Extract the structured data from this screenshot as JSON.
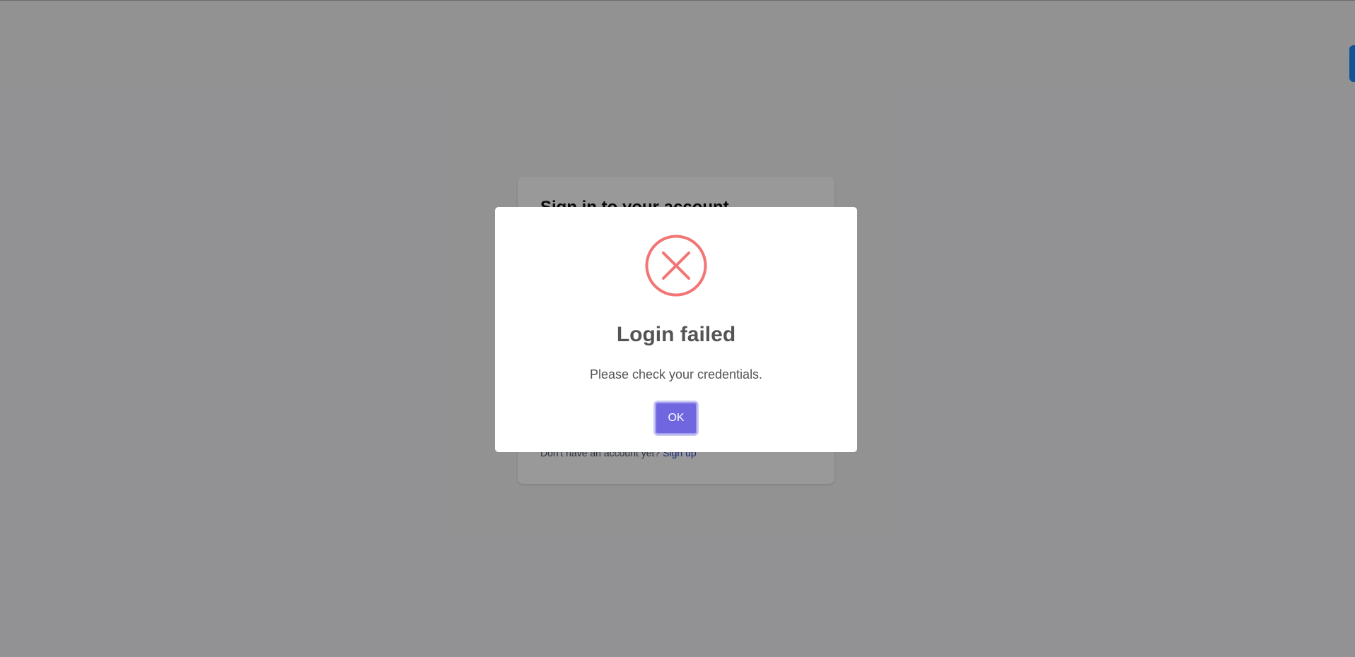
{
  "background": {
    "login_card": {
      "title": "Sign in to your account",
      "signup_prompt": "Don't have an account yet?",
      "signup_link": "Sign up"
    }
  },
  "modal": {
    "icon": "error-x-circle-icon",
    "title": "Login failed",
    "message": "Please check your credentials.",
    "ok_label": "OK"
  },
  "colors": {
    "accent": "#7066e0",
    "error": "#f27474",
    "link": "#2b4acb",
    "side_tab": "#1a8cff"
  }
}
